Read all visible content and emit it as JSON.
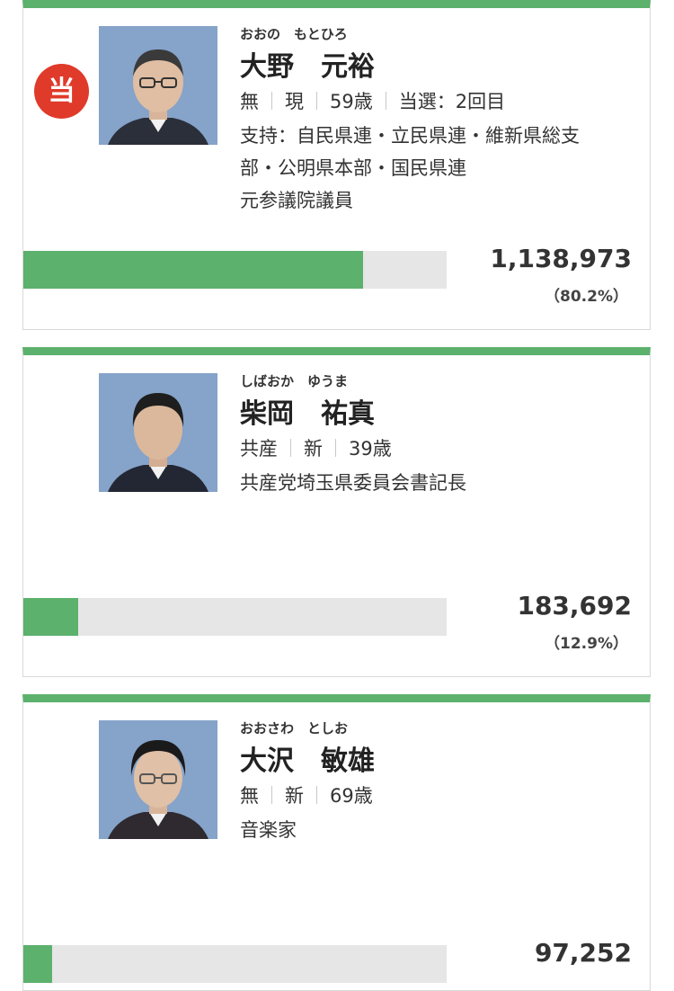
{
  "candidates": [
    {
      "winner_mark": "当",
      "kana": "おおの　もとひろ",
      "name": "大野　元裕",
      "party": "無",
      "status": "現",
      "age": "59歳",
      "elected_count": "当選：2回目",
      "support_line1": "支持：自民県連・立民県連・維新県総支",
      "support_line2": "部・公明県本部・国民県連",
      "career": "元参議院議員",
      "votes": "1,138,973",
      "percent": "（80.2%）",
      "vote_share": 0.802,
      "photo_icon": "person-portrait-icon"
    },
    {
      "kana": "しばおか　ゆうま",
      "name": "柴岡　祐真",
      "party": "共産",
      "status": "新",
      "age": "39歳",
      "career": "共産党埼玉県委員会書記長",
      "votes": "183,692",
      "percent": "（12.9%）",
      "vote_share": 0.129,
      "photo_icon": "person-portrait-icon"
    },
    {
      "kana": "おおさわ　としお",
      "name": "大沢　敏雄",
      "party": "無",
      "status": "新",
      "age": "69歳",
      "career": "音楽家",
      "votes": "97,252",
      "vote_share": 0.068,
      "photo_icon": "person-portrait-icon"
    }
  ],
  "colors": {
    "accent_green": "#5cb16c",
    "winner_red": "#e03a2a",
    "bar_track": "#e6e6e6"
  }
}
